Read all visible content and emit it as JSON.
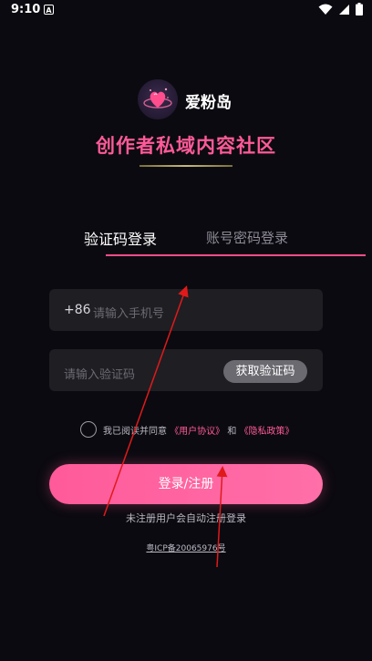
{
  "status_bar": {
    "time": "9:10",
    "notif_badge": "A"
  },
  "header": {
    "app_name": "爱粉岛",
    "slogan": "创作者私域内容社区"
  },
  "tabs": [
    {
      "label": "验证码登录",
      "active": true
    },
    {
      "label": "账号密码登录",
      "active": false
    }
  ],
  "phone_field": {
    "prefix": "+86",
    "placeholder": "请输入手机号"
  },
  "code_field": {
    "placeholder": "请输入验证码",
    "button_label": "获取验证码"
  },
  "agreement": {
    "prefix": "我已阅读并同意",
    "user_agreement": "《用户协议》",
    "and": "和",
    "privacy_policy": "《隐私政策》"
  },
  "login_button": "登录/注册",
  "hint": "未注册用户会自动注册登录",
  "icp": "粤ICP备20065976号",
  "colors": {
    "accent": "#ff5a99",
    "background": "#0b0a10",
    "field": "#1f1e23"
  },
  "icons": [
    "wifi-icon",
    "signal-icon",
    "battery-icon",
    "heart-logo-icon"
  ]
}
